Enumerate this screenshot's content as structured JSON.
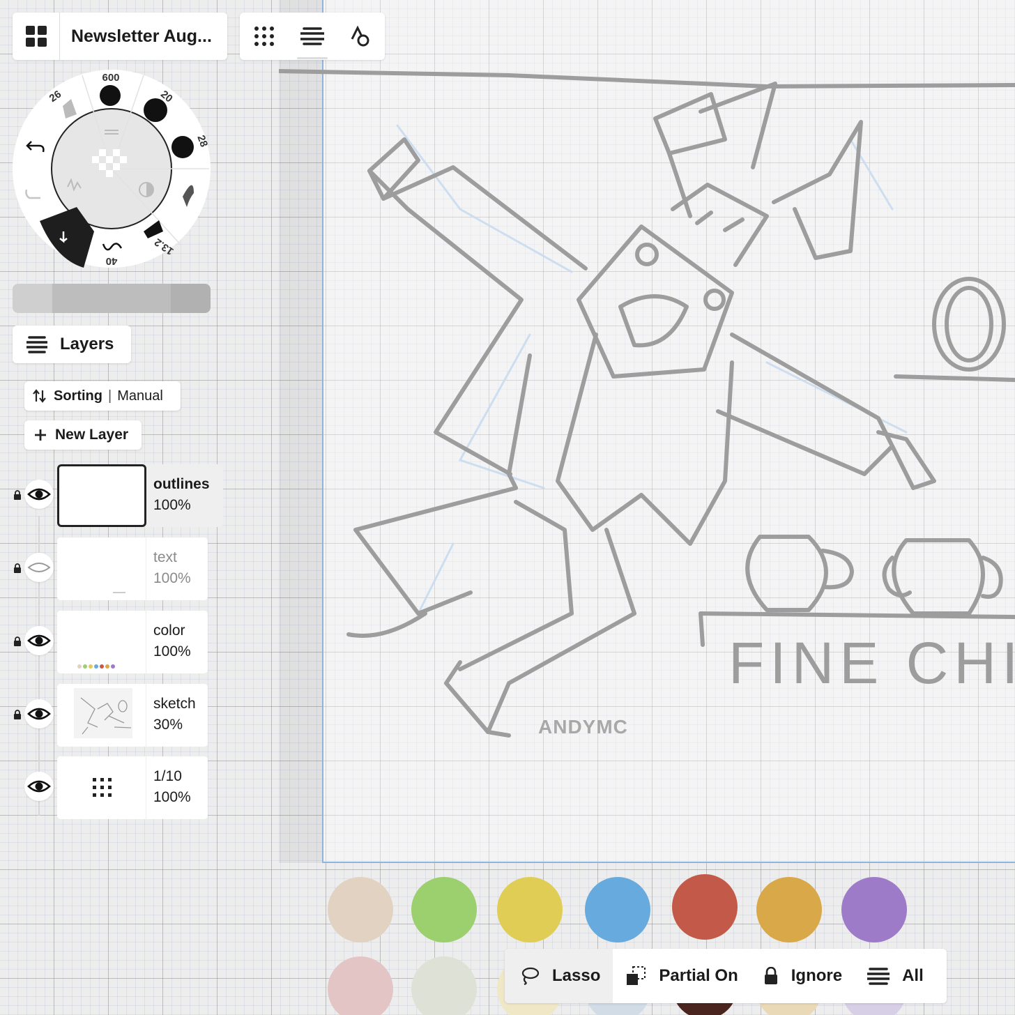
{
  "document": {
    "title": "Newsletter Aug..."
  },
  "toolbar": {
    "tools": [
      {
        "name": "grid",
        "icon": "grid-dots-icon"
      },
      {
        "name": "layers",
        "icon": "layers-icon"
      },
      {
        "name": "shapes",
        "icon": "shapes-icon"
      }
    ]
  },
  "brush_wheel": {
    "sizes": [
      "600",
      "20",
      "28",
      "13.2",
      "40",
      "26"
    ],
    "undo_icon": "undo-icon",
    "redo_icon": "redo-icon"
  },
  "layers_panel": {
    "title": "Layers",
    "sorting_label": "Sorting",
    "sorting_value": "Manual",
    "new_layer_label": "New Layer",
    "layers": [
      {
        "name": "outlines",
        "opacity": "100%",
        "visible": true,
        "locked": true,
        "selected": true
      },
      {
        "name": "text",
        "opacity": "100%",
        "visible": false,
        "locked": true,
        "selected": false
      },
      {
        "name": "color",
        "opacity": "100%",
        "visible": true,
        "locked": true,
        "selected": false
      },
      {
        "name": "sketch",
        "opacity": "30%",
        "visible": true,
        "locked": true,
        "selected": false
      },
      {
        "name": "1/10",
        "opacity": "100%",
        "visible": true,
        "locked": false,
        "selected": false
      }
    ]
  },
  "canvas": {
    "signature": "ANDYMC",
    "sign_text": "FINE CHIN"
  },
  "palette": {
    "colors": [
      "#e1d2c2",
      "#9ccf6e",
      "#dfcd55",
      "#67aade",
      "#c35a49",
      "#d9a849",
      "#9e7bc9"
    ],
    "second_row": [
      "#e4c5c5",
      "#dde1d6",
      "#efe7c5",
      "#d1dce6",
      "#4a2520",
      "#ead9b6",
      "#d7cfe6"
    ]
  },
  "selection_bar": {
    "lasso": "Lasso",
    "partial": "Partial On",
    "ignore": "Ignore",
    "all": "All"
  }
}
